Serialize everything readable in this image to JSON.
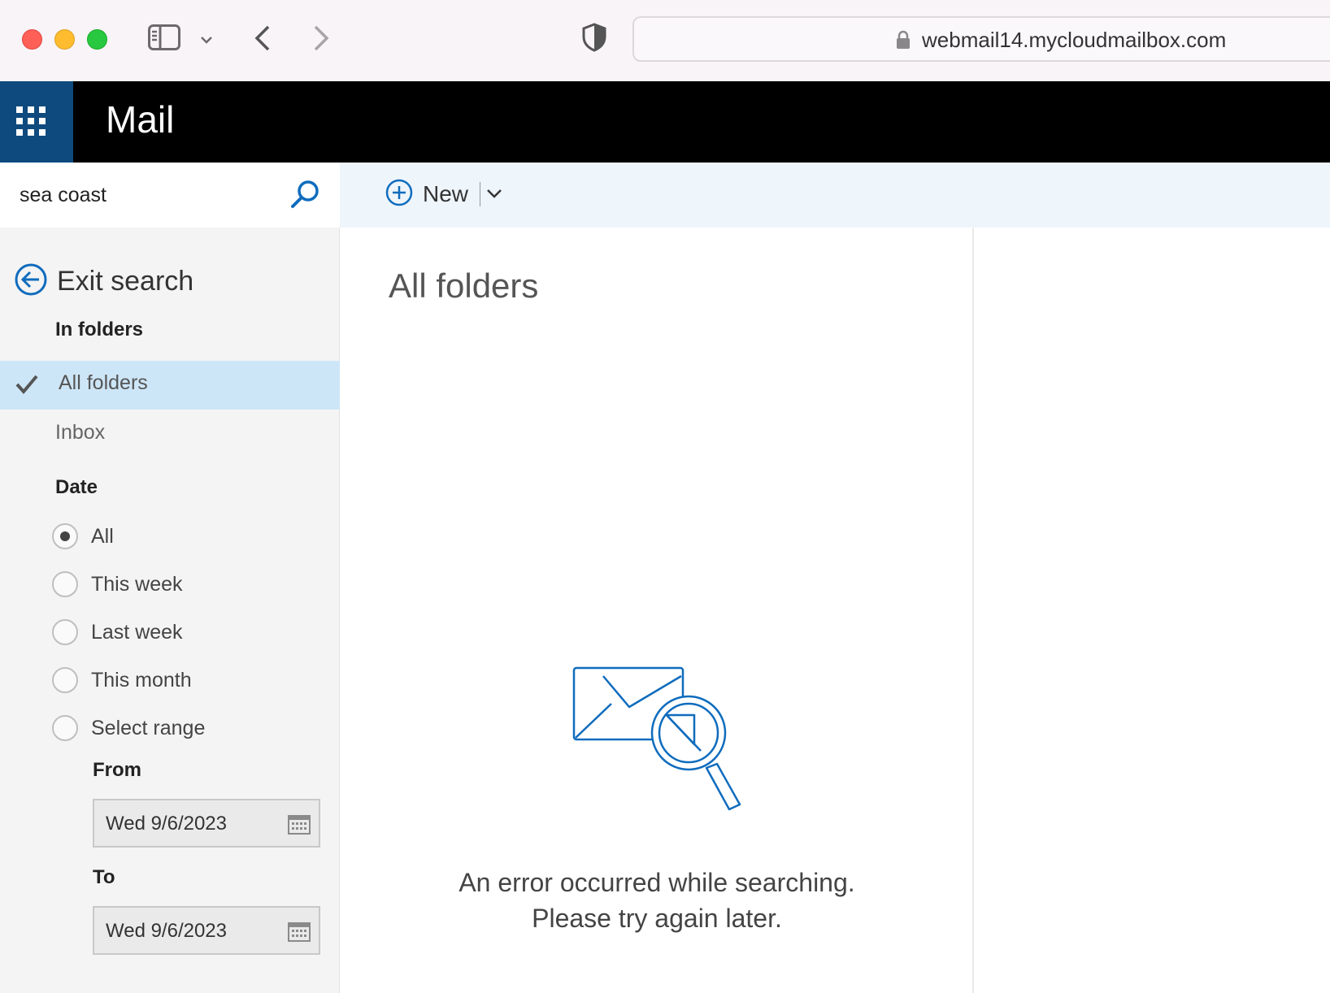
{
  "browser": {
    "url": "webmail14.mycloudmailbox.com"
  },
  "app": {
    "title": "Mail"
  },
  "search": {
    "query": "sea coast"
  },
  "left_pane": {
    "exit_label": "Exit search",
    "in_folders_heading": "In folders",
    "folders": [
      {
        "label": "All folders",
        "selected": true
      },
      {
        "label": "Inbox",
        "selected": false
      }
    ],
    "date_heading": "Date",
    "date_options": [
      {
        "label": "All",
        "selected": true
      },
      {
        "label": "This week",
        "selected": false
      },
      {
        "label": "Last week",
        "selected": false
      },
      {
        "label": "This month",
        "selected": false
      },
      {
        "label": "Select range",
        "selected": false
      }
    ],
    "from_label": "From",
    "from_value": "Wed 9/6/2023",
    "to_label": "To",
    "to_value": "Wed 9/6/2023"
  },
  "toolbar": {
    "new_label": "New"
  },
  "list": {
    "title": "All folders",
    "error_line1": "An error occurred while searching.",
    "error_line2": "Please try again later."
  },
  "colors": {
    "accent": "#0f6cbd",
    "selected_bg": "#cde6f7",
    "header_bg": "#000000",
    "waffle_bg": "#0f4a7e"
  }
}
